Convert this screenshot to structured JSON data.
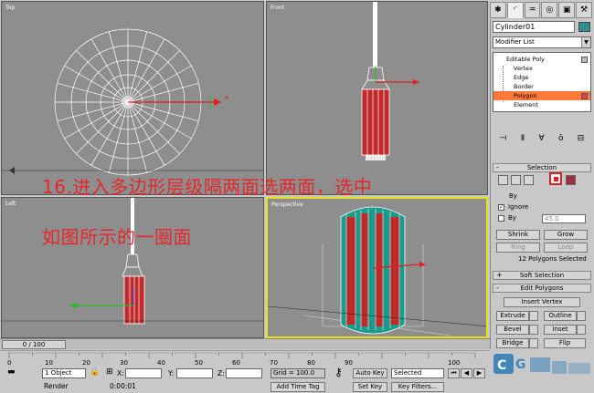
{
  "viewports": {
    "top": "Top",
    "front": "Front",
    "left": "Left",
    "perspective": "Perspective"
  },
  "caption": {
    "line1": "16.进入多边形层级隔两面选两面，选中",
    "line2": "如图所示的一圈面"
  },
  "command_panel": {
    "object_name": "Cylinder01",
    "modifier_list": "Modifier List",
    "stack": {
      "root": "Editable Poly",
      "items": [
        "Vertex",
        "Edge",
        "Border",
        "Polygon",
        "Element"
      ],
      "selected": "Polygon"
    },
    "selection": {
      "title": "Selection",
      "by_label": "By",
      "ignore_label": "Ignore",
      "by_angle_label": "By",
      "angle_value": "45.0",
      "shrink": "Shrink",
      "grow": "Grow",
      "ring": "Ring",
      "loop": "Loop",
      "status": "12 Polygons Selected"
    },
    "soft_selection": "Soft Selection",
    "edit_polygons": {
      "title": "Edit Polygons",
      "insert_vertex": "Insert Vertex",
      "extrude": "Extrude",
      "outline": "Outline",
      "bevel": "Bevel",
      "inset": "Inset",
      "bridge": "Bridge",
      "flip": "Flip"
    }
  },
  "timeline": {
    "slider": "0 / 100",
    "ticks": [
      "0",
      "10",
      "20",
      "30",
      "40",
      "50",
      "60",
      "70",
      "80",
      "90",
      "100"
    ]
  },
  "status": {
    "objects": "1 Object",
    "x_label": "X:",
    "y_label": "Y:",
    "z_label": "Z:",
    "grid": "Grid = 100.0",
    "auto_key": "Auto Key",
    "selected": "Selected",
    "set_key": "Set Key",
    "key_filters": "Key Filters...",
    "render": "Render",
    "add_time": "Add Time Tag",
    "time": "0:00:01"
  },
  "colors": {
    "viewport_bg": "#8e8e8e",
    "active_border": "#e8e018",
    "caption": "#e8262a",
    "selected_stack": "#ff7a3a"
  }
}
